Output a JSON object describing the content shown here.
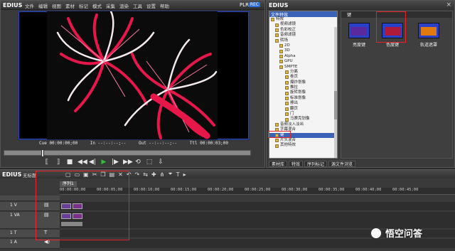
{
  "app": {
    "logo": "EDIUS"
  },
  "menu": [
    "文件",
    "编辑",
    "视图",
    "素材",
    "标记",
    "模式",
    "采集",
    "渲染",
    "工具",
    "设置",
    "帮助"
  ],
  "player": {
    "plr_label": "PLR",
    "rec_label": "REC",
    "timecodes": {
      "cue": "Cue 00:00:00;00",
      "in": "In --:--:--;--",
      "out": "Out --:--:--;--",
      "ttl": "Ttl 00:00:03;00"
    }
  },
  "effects": {
    "title": "EDIUS",
    "tree_header": "文件特效",
    "tree_rows": [
      "特效",
      "视频滤镜",
      "色彩校正",
      "音频滤镜",
      "转场",
      "2D",
      "3D",
      "Alpha",
      "GPU",
      "SMPTE",
      "分离",
      "卷页",
      "爆炸划像",
      "推拉",
      "旋转划像",
      "标准划像",
      "擦出",
      "翻页",
      "门",
      "马赛克划像",
      "音频淡入淡出",
      "字幕混合",
      "键",
      "片头混合",
      "其他特效"
    ],
    "selected_row": "键",
    "folder_label": "键",
    "thumbs": [
      {
        "label": "亮度键",
        "color": "#5a2a9c"
      },
      {
        "label": "色度键",
        "color": "#b01a3a"
      },
      {
        "label": "轨道遮罩",
        "color": "#e07a10"
      }
    ],
    "bottom_tabs": [
      "素材库",
      "特效",
      "序列标记",
      "源文件浏览"
    ]
  },
  "timeline": {
    "logo": "EDIUS",
    "project": "无标题",
    "sequence_tab": "序列1",
    "ruler": [
      "00:00:00;00",
      "00:00:05;00",
      "00:00:10;00",
      "00:00:15;00",
      "00:00:20;00",
      "00:00:25;00",
      "00:00:30;00",
      "00:00:35;00",
      "00:00:40;00",
      "00:00:45;00"
    ],
    "tracks": [
      {
        "name": "1 V",
        "mark": "▤"
      },
      {
        "name": "1 VA",
        "mark": "▤"
      },
      {
        "name": "1 T",
        "mark": "T"
      },
      {
        "name": "1 A",
        "mark": "◀)"
      }
    ],
    "clips": [
      "clip-1",
      "clip-2"
    ]
  },
  "watermark": {
    "text": "悟空问答"
  }
}
